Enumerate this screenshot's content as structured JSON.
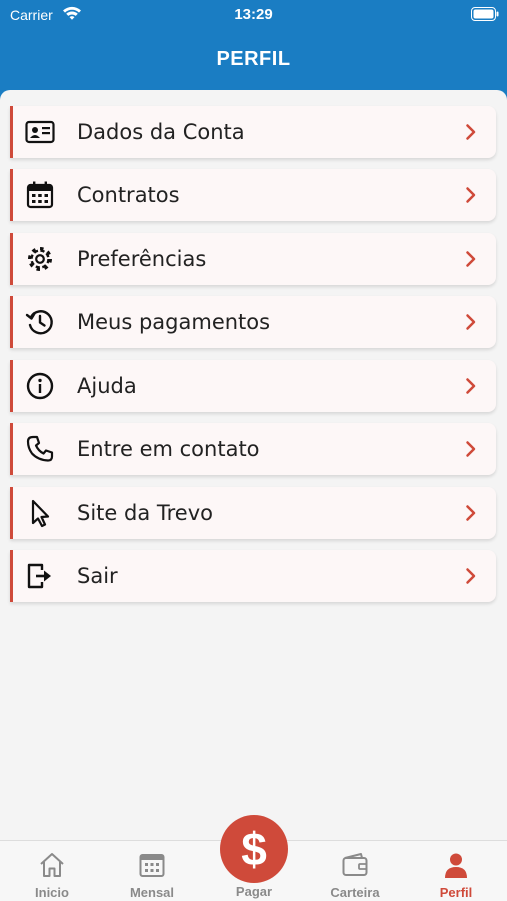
{
  "status_bar": {
    "carrier": "Carrier",
    "time": "13:29"
  },
  "header": {
    "title": "PERFIL"
  },
  "menu": {
    "items": [
      {
        "label": "Dados da Conta",
        "icon": "id-card-icon"
      },
      {
        "label": "Contratos",
        "icon": "calendar-icon"
      },
      {
        "label": "Preferências",
        "icon": "gear-icon"
      },
      {
        "label": "Meus pagamentos",
        "icon": "history-icon"
      },
      {
        "label": "Ajuda",
        "icon": "info-icon"
      },
      {
        "label": "Entre em contato",
        "icon": "phone-icon"
      },
      {
        "label": "Site da Trevo",
        "icon": "cursor-icon"
      },
      {
        "label": "Sair",
        "icon": "logout-icon"
      }
    ]
  },
  "tabbar": {
    "tabs": [
      {
        "label": "Inicio",
        "icon": "home-icon"
      },
      {
        "label": "Mensal",
        "icon": "calendar-icon"
      },
      {
        "label": "Pagar",
        "icon": "dollar-icon",
        "symbol": "$"
      },
      {
        "label": "Carteira",
        "icon": "wallet-icon"
      },
      {
        "label": "Perfil",
        "icon": "user-icon",
        "active": true
      }
    ]
  },
  "colors": {
    "header": "#1a7dc3",
    "accent": "#cf4a3a",
    "inactive": "#8a8a8a"
  }
}
